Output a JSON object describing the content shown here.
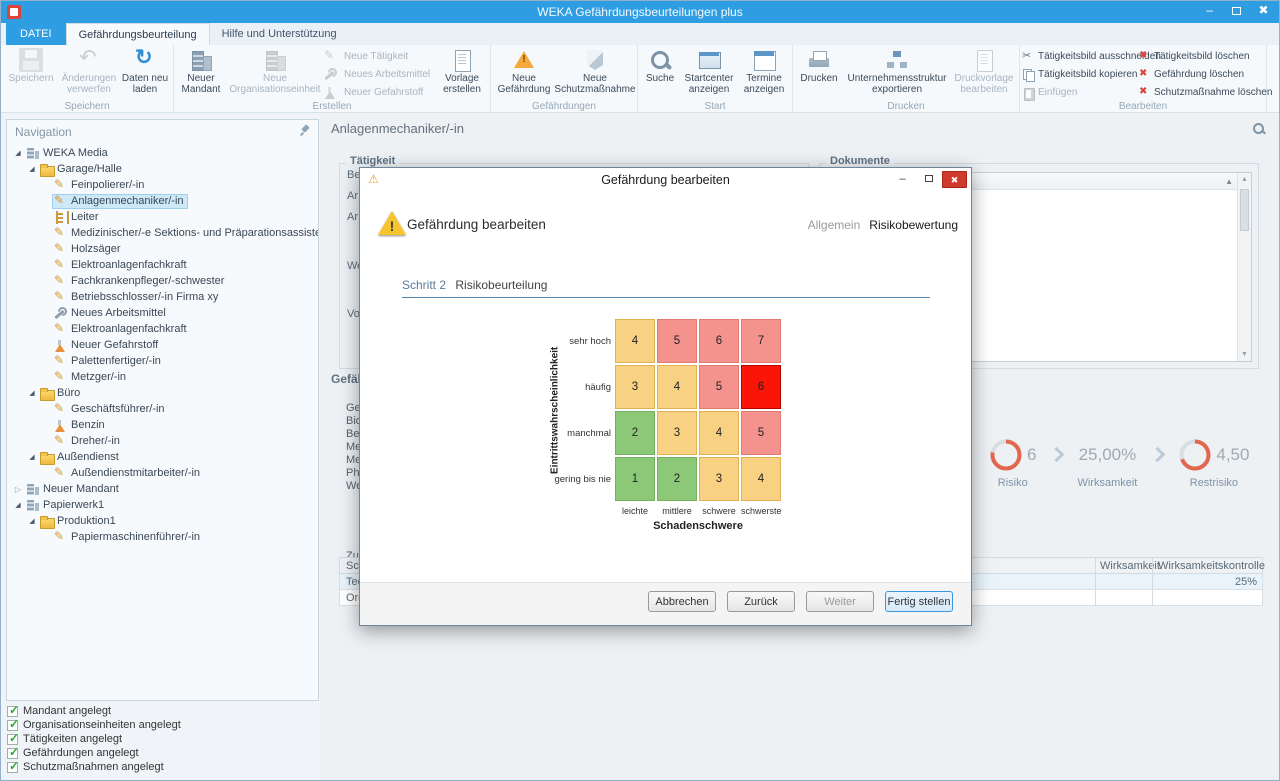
{
  "window": {
    "title": "WEKA Gefährdungsbeurteilungen plus"
  },
  "icons": {
    "minimize": "–",
    "close": "✖",
    "warning": "⚠",
    "expander_expanded": "◢",
    "expander_collapsed": "▷",
    "sort_asc": "▲",
    "scroll_up": "▲",
    "scroll_down": "▼",
    "check": "✓"
  },
  "colors": {
    "titlebar": "#2f9de2",
    "matrix_green": "#8cc878",
    "matrix_yellow": "#f8d282",
    "matrix_pink": "#f4928e",
    "matrix_red_selected": "#fb1408",
    "gauge_arc": "#e2674e"
  },
  "ribbon": {
    "tabs": {
      "file": "DATEI",
      "main": "Gefährdungsbeurteilung",
      "help": "Hilfe und Unterstützung"
    },
    "speichern": {
      "label": "Speichern",
      "save": "Speichern",
      "discard": "Änderungen verwerfen",
      "reload": "Daten neu laden"
    },
    "erstellen": {
      "label": "Erstellen",
      "neuer_mandant": "Neuer Mandant",
      "neue_organisationseinheit": "Neue Organisationseinheit",
      "neue_taetigkeit": "Neue Tätigkeit",
      "neues_arbeitsmittel": "Neues Arbeitsmittel",
      "neuer_gefahrstoff": "Neuer Gefahrstoff",
      "vorlage_erstellen": "Vorlage erstellen"
    },
    "gefaehrdungen": {
      "label": "Gefährdungen",
      "neue_gefaehrdung": "Neue Gefährdung",
      "neue_schutzmassnahme": "Neue Schutzmaßnahme"
    },
    "start": {
      "label": "Start",
      "suche": "Suche",
      "startcenter": "Startcenter anzeigen",
      "termine": "Termine anzeigen"
    },
    "drucken": {
      "label": "Drucken",
      "drucken": "Drucken",
      "unternehmensstruktur": "Unternehmensstruktur exportieren",
      "druckvorlage": "Druckvorlage bearbeiten"
    },
    "bearbeiten": {
      "label": "Bearbeiten",
      "ausschneiden": "Tätigkeitsbild ausschneiden",
      "kopieren": "Tätigkeitsbild kopieren",
      "einfuegen": "Einfügen",
      "bild_loeschen": "Tätigkeitsbild löschen",
      "gefaehrdung_loeschen": "Gefährdung löschen",
      "schutzmassnahme_loeschen": "Schutzmaßnahme löschen"
    }
  },
  "navigation": {
    "title": "Navigation",
    "items": [
      {
        "label": "WEKA Media",
        "level": 0,
        "icon": "building",
        "expander": "expanded"
      },
      {
        "label": "Garage/Halle",
        "level": 1,
        "icon": "folder",
        "expander": "expanded"
      },
      {
        "label": "Feinpolierer/-in",
        "level": 2,
        "icon": "activity"
      },
      {
        "label": "Anlagenmechaniker/-in",
        "level": 2,
        "icon": "activity",
        "selected": true
      },
      {
        "label": "Leiter",
        "level": 2,
        "icon": "ladder"
      },
      {
        "label": "Medizinischer/-e Sektions- und Präparationsassistent/-in",
        "level": 2,
        "icon": "activity"
      },
      {
        "label": "Holzsäger",
        "level": 2,
        "icon": "activity"
      },
      {
        "label": "Elektroanlagenfachkraft",
        "level": 2,
        "icon": "activity"
      },
      {
        "label": "Fachkrankenpfleger/-schwester",
        "level": 2,
        "icon": "activity"
      },
      {
        "label": "Betriebsschlosser/-in Firma xy",
        "level": 2,
        "icon": "activity"
      },
      {
        "label": "Neues Arbeitsmittel",
        "level": 2,
        "icon": "tool"
      },
      {
        "label": "Elektroanlagenfachkraft",
        "level": 2,
        "icon": "activity"
      },
      {
        "label": "Neuer Gefahrstoff",
        "level": 2,
        "icon": "substance"
      },
      {
        "label": "Palettenfertiger/-in",
        "level": 2,
        "icon": "activity"
      },
      {
        "label": "Metzger/-in",
        "level": 2,
        "icon": "activity"
      },
      {
        "label": "Büro",
        "level": 1,
        "icon": "folder",
        "expander": "expanded"
      },
      {
        "label": "Geschäftsführer/-in",
        "level": 2,
        "icon": "activity"
      },
      {
        "label": "Benzin",
        "level": 2,
        "icon": "substance"
      },
      {
        "label": "Dreher/-in",
        "level": 2,
        "icon": "activity"
      },
      {
        "label": "Außendienst",
        "level": 1,
        "icon": "folder",
        "expander": "expanded"
      },
      {
        "label": "Außendienstmitarbeiter/-in",
        "level": 2,
        "icon": "activity"
      },
      {
        "label": "Neuer Mandant",
        "level": 0,
        "icon": "building",
        "expander": "collapsed"
      },
      {
        "label": "Papierwerk1",
        "level": 0,
        "icon": "building",
        "expander": "expanded"
      },
      {
        "label": "Produktion1",
        "level": 1,
        "icon": "folder",
        "expander": "expanded"
      },
      {
        "label": "Papiermaschinenführer/-in",
        "level": 2,
        "icon": "activity"
      }
    ]
  },
  "status_checks": [
    "Mandant angelegt",
    "Organisationseinheiten angelegt",
    "Tätigkeiten angelegt",
    "Gefährdungen angelegt",
    "Schutzmaßnahmen angelegt"
  ],
  "main": {
    "page_title": "Anlagenmechaniker/-in",
    "taetigkeit": {
      "label": "Tätigkeit",
      "field_fragments": [
        "Be",
        "Ar",
        "Ar",
        "We",
        "Vo"
      ]
    },
    "dokumente": {
      "label": "Dokumente"
    },
    "gefaehrdung": {
      "label": "Gefährdung",
      "row_fragments": [
        "Gefä",
        "Bio",
        "Bela",
        "Me",
        "Me",
        "Phy",
        "We"
      ]
    },
    "risk_summary": {
      "risiko": {
        "value": "6",
        "label": "Risiko"
      },
      "wirksamkeit": {
        "value": "25,00%",
        "label": "Wirksamkeit"
      },
      "restrisiko": {
        "value": "4,50",
        "label": "Restrisiko"
      }
    },
    "massnahmen_table": {
      "section_fragment": "Zug",
      "first_col_fragment": "Sch",
      "header_wirksamkeit": "Wirksamkeit",
      "header_wirksamkeitskontrolle": "Wirksamkeitskontrolle",
      "rows": [
        {
          "fragment": "Tec",
          "value": "25%"
        },
        {
          "fragment": "Org",
          "value": ""
        }
      ]
    }
  },
  "dialog": {
    "title": "Gefährdung bearbeiten",
    "header_title": "Gefährdung bearbeiten",
    "tabs": {
      "allgemein": "Allgemein",
      "risikobewertung": "Risikobewertung"
    },
    "step_label": "Schritt 2",
    "step_title": "Risikobeurteilung",
    "matrix": {
      "y_axis_label": "Eintrittswahrscheinlichkeit",
      "x_axis_label": "Schadenschwere",
      "rows": [
        "sehr hoch",
        "häufig",
        "manchmal",
        "gering bis nie"
      ],
      "cols": [
        "leichte",
        "mittlere",
        "schwere",
        "schwerste"
      ],
      "values": [
        [
          4,
          5,
          6,
          7
        ],
        [
          3,
          4,
          5,
          6
        ],
        [
          2,
          3,
          4,
          5
        ],
        [
          1,
          2,
          3,
          4
        ]
      ],
      "colors": [
        [
          "yellow",
          "pink",
          "pink",
          "pink"
        ],
        [
          "yellow",
          "yellow",
          "pink",
          "red"
        ],
        [
          "green",
          "yellow",
          "yellow",
          "pink"
        ],
        [
          "green",
          "green",
          "yellow",
          "yellow"
        ]
      ],
      "selected_cell": {
        "row_label": "häufig",
        "col_label": "schwerste",
        "value": 6
      }
    },
    "buttons": {
      "abbrechen": "Abbrechen",
      "zurueck": "Zurück",
      "weiter": "Weiter",
      "fertig_stellen": "Fertig stellen"
    }
  }
}
